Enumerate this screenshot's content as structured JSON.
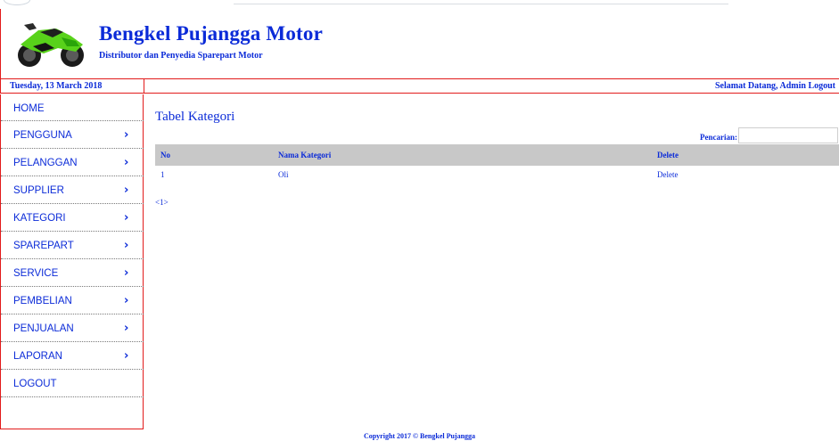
{
  "header": {
    "title": "Bengkel Pujangga Motor",
    "subtitle": "Distributor dan Penyedia Sparepart Motor"
  },
  "datebar": {
    "date": "Tuesday, 13 March 2018",
    "welcome": "Selamat Datang, Admin",
    "logout": "Logout"
  },
  "sidebar": {
    "items": [
      {
        "label": "HOME",
        "chevron": false
      },
      {
        "label": "PENGGUNA",
        "chevron": true
      },
      {
        "label": "PELANGGAN",
        "chevron": true
      },
      {
        "label": "SUPPLIER",
        "chevron": true
      },
      {
        "label": "KATEGORI",
        "chevron": true
      },
      {
        "label": "SPAREPART",
        "chevron": true
      },
      {
        "label": "SERVICE",
        "chevron": true
      },
      {
        "label": "PEMBELIAN",
        "chevron": true
      },
      {
        "label": "PENJUALAN",
        "chevron": true
      },
      {
        "label": "LAPORAN",
        "chevron": true
      },
      {
        "label": "LOGOUT",
        "chevron": false
      }
    ]
  },
  "main": {
    "title": "Tabel Kategori",
    "search": {
      "label": "Pencarian:",
      "value": "",
      "placeholder": ""
    },
    "table": {
      "columns": [
        "No",
        "Nama Kategori",
        "Delete"
      ],
      "rows": [
        {
          "no": "1",
          "name": "Oli",
          "action": "Delete"
        }
      ]
    },
    "pager": "<1>"
  },
  "footer": "Copyright 2017 © Bengkel Pujangga",
  "colors": {
    "accent": "#0b2bd8",
    "border": "#e21b1b",
    "table_header": "#c8c8c8"
  }
}
